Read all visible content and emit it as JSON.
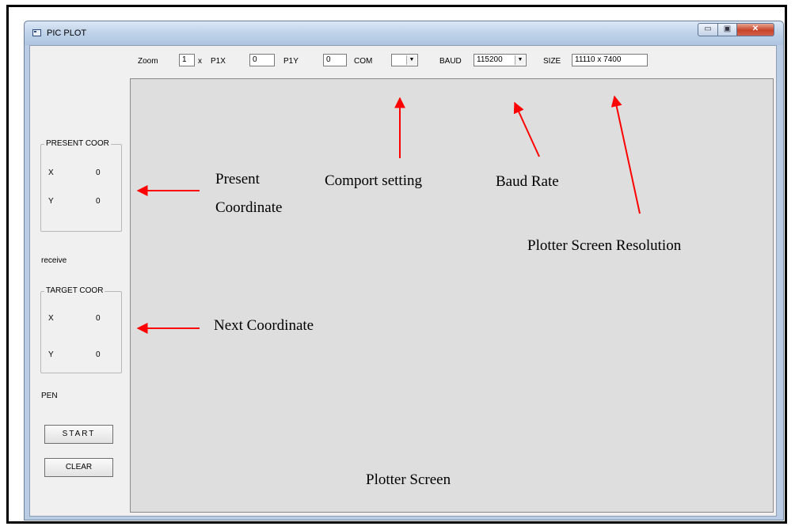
{
  "window": {
    "title": "PIC PLOT",
    "min_icon": "▭",
    "max_icon": "▣",
    "close_icon": "✕"
  },
  "toolbar": {
    "zoom_label": "Zoom",
    "zoom_value": "1",
    "x_label": "x",
    "p1x_label": "P1X",
    "p1x_value": "0",
    "p1y_label": "P1Y",
    "p1y_value": "0",
    "com_label": "COM",
    "com_value": "",
    "baud_label": "BAUD",
    "baud_value": "115200",
    "size_label": "SIZE",
    "size_value": "11110 x 7400"
  },
  "present_coor": {
    "title": "PRESENT COOR",
    "x_label": "X",
    "x_value": "0",
    "y_label": "Y",
    "y_value": "0"
  },
  "receive_label": "receive",
  "target_coor": {
    "title": "TARGET COOR",
    "x_label": "X",
    "x_value": "0",
    "y_label": "Y",
    "y_value": "0"
  },
  "pen_label": "PEN",
  "buttons": {
    "start": "START",
    "clear": "CLEAR"
  },
  "annotations": {
    "present_line1": "Present",
    "present_line2": "Coordinate",
    "comport": "Comport setting",
    "baud": "Baud Rate",
    "resolution": "Plotter Screen Resolution",
    "next": "Next Coordinate",
    "plotter": "Plotter Screen"
  },
  "colors": {
    "arrow": "#ff0000",
    "plot_area": "#dedede",
    "window_chrome": "#b9cce3"
  }
}
